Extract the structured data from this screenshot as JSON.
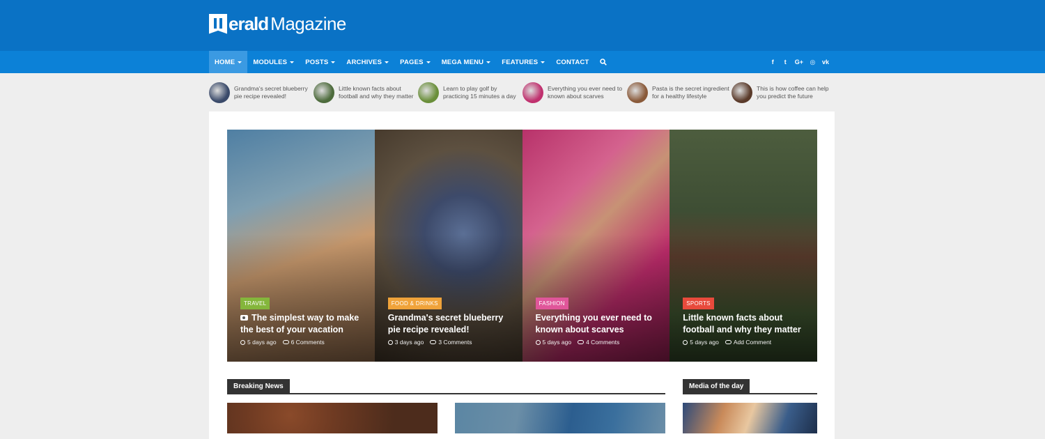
{
  "brand": {
    "name_strong": "erald",
    "name_light": "Magazine"
  },
  "nav": {
    "items": [
      {
        "label": "HOME",
        "caret": true,
        "active": true
      },
      {
        "label": "MODULES",
        "caret": true
      },
      {
        "label": "POSTS",
        "caret": true
      },
      {
        "label": "ARCHIVES",
        "caret": true
      },
      {
        "label": "PAGES",
        "caret": true
      },
      {
        "label": "MEGA MENU",
        "caret": true
      },
      {
        "label": "FEATURES",
        "caret": true
      },
      {
        "label": "CONTACT",
        "caret": false
      }
    ],
    "social": [
      "f",
      "t",
      "G+",
      "◎",
      "vk"
    ]
  },
  "ticker": [
    {
      "text": "Grandma's secret blueberry pie recipe revealed!",
      "color": "#3a4a6a"
    },
    {
      "text": "Little known facts about football and why they matter",
      "color": "#4d6b3c"
    },
    {
      "text": "Learn to play golf by practicing 15 minutes a day",
      "color": "#6a8f3a"
    },
    {
      "text": "Everything you ever need to known about scarves",
      "color": "#c0306e"
    },
    {
      "text": "Pasta is the secret ingredient for a healthy lifestyle",
      "color": "#8a5a3a"
    },
    {
      "text": "This is how coffee can help you predict the future",
      "color": "#5a3a2a"
    }
  ],
  "slides": [
    {
      "category": "TRAVEL",
      "cat_color": "#84b63b",
      "title": "The simplest way to make the best of your vacation",
      "camera": true,
      "time": "5 days ago",
      "comments": "6 Comments",
      "bg": "linear-gradient(160deg,#4f7fa3 0%,#7f9fb1 30%,#c99a6e 55%,#8a6648 100%)"
    },
    {
      "category": "FOOD & DRINKS",
      "cat_color": "#f0a33a",
      "title": "Grandma's secret blueberry pie recipe revealed!",
      "camera": false,
      "time": "3 days ago",
      "comments": "3 Comments",
      "bg": "radial-gradient(circle at 60% 45%,#5b6f95 0%,#3d4a6a 25%,#5d5040 55%,#3f3326 100%)"
    },
    {
      "category": "FASHION",
      "cat_color": "#e0569a",
      "title": "Everything you ever need to known about scarves",
      "camera": false,
      "time": "5 days ago",
      "comments": "4 Comments",
      "bg": "linear-gradient(135deg,#b8326a 0%,#d4628e 30%,#c79275 45%,#bf2c6c 70%,#8e1e4f 100%)"
    },
    {
      "category": "SPORTS",
      "cat_color": "#e84a3c",
      "title": "Little known facts about football and why they matter",
      "camera": false,
      "time": "5 days ago",
      "comments": "Add Comment",
      "bg": "linear-gradient(180deg,#4d5d3e 0%,#3e4e34 35%,#5a3b2c 55%,#3f5530 80%,#2e4225 100%)"
    }
  ],
  "sections": {
    "breaking": "Breaking News",
    "media": "Media of the day"
  }
}
